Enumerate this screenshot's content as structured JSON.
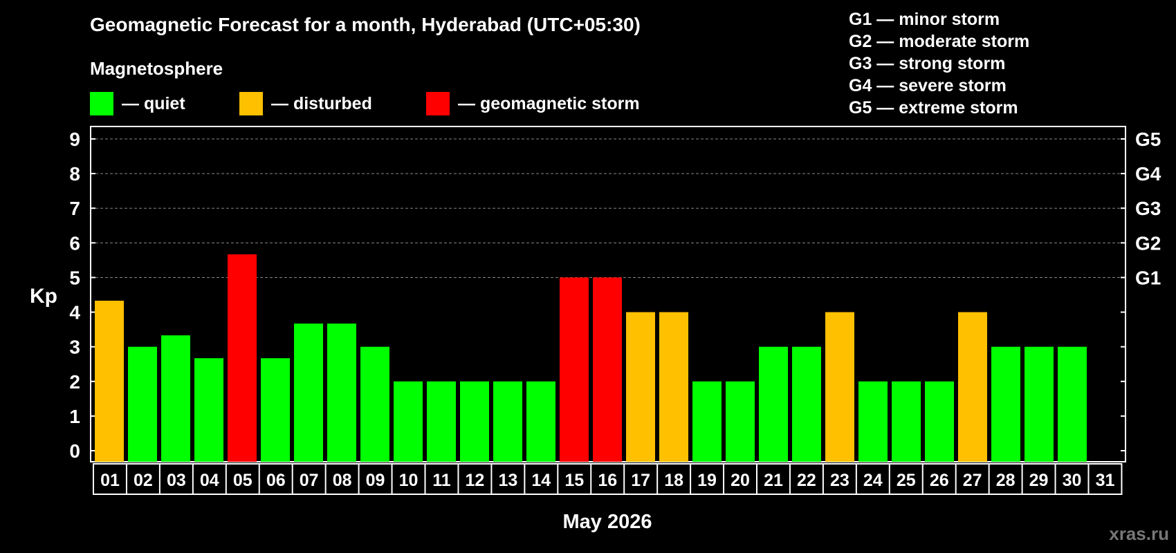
{
  "header": {
    "title": "Geomagnetic Forecast for a month, Hyderabad (UTC+05:30)",
    "subtitle": "Magnetosphere"
  },
  "legend": {
    "quiet": {
      "label": "— quiet",
      "color": "#00ff00"
    },
    "disturbed": {
      "label": "— disturbed",
      "color": "#ffc000"
    },
    "storm": {
      "label": "— geomagnetic storm",
      "color": "#ff0000"
    }
  },
  "g_legend": [
    "G1 — minor storm",
    "G2 — moderate storm",
    "G3 — strong storm",
    "G4 — severe storm",
    "G5 — extreme storm"
  ],
  "watermark": "xras.ru",
  "chart_data": {
    "type": "bar",
    "title": "Geomagnetic Forecast for a month, Hyderabad (UTC+05:30)",
    "xlabel": "May 2026",
    "ylabel": "Kp",
    "ylim": [
      0,
      9
    ],
    "yticks": [
      "0",
      "1",
      "2",
      "3",
      "4",
      "5",
      "6",
      "7",
      "8",
      "9"
    ],
    "right_ticks": [
      {
        "kp": 5,
        "label": "G1"
      },
      {
        "kp": 6,
        "label": "G2"
      },
      {
        "kp": 7,
        "label": "G3"
      },
      {
        "kp": 8,
        "label": "G4"
      },
      {
        "kp": 9,
        "label": "G5"
      }
    ],
    "grid": "dashed lines at Kp 5–9",
    "categories": [
      "01",
      "02",
      "03",
      "04",
      "05",
      "06",
      "07",
      "08",
      "09",
      "10",
      "11",
      "12",
      "13",
      "14",
      "15",
      "16",
      "17",
      "18",
      "19",
      "20",
      "21",
      "22",
      "23",
      "24",
      "25",
      "26",
      "27",
      "28",
      "29",
      "30",
      "31"
    ],
    "values": [
      4.33,
      3,
      3.33,
      2.67,
      5.67,
      2.67,
      3.67,
      3.67,
      3,
      2,
      2,
      2,
      2,
      2,
      5,
      5,
      4,
      4,
      2,
      2,
      3,
      3,
      4,
      2,
      2,
      2,
      4,
      3,
      3,
      3,
      null
    ],
    "status": [
      "disturbed",
      "quiet",
      "quiet",
      "quiet",
      "storm",
      "quiet",
      "quiet",
      "quiet",
      "quiet",
      "quiet",
      "quiet",
      "quiet",
      "quiet",
      "quiet",
      "storm",
      "storm",
      "disturbed",
      "disturbed",
      "quiet",
      "quiet",
      "quiet",
      "quiet",
      "disturbed",
      "quiet",
      "quiet",
      "quiet",
      "disturbed",
      "quiet",
      "quiet",
      "quiet",
      null
    ]
  }
}
